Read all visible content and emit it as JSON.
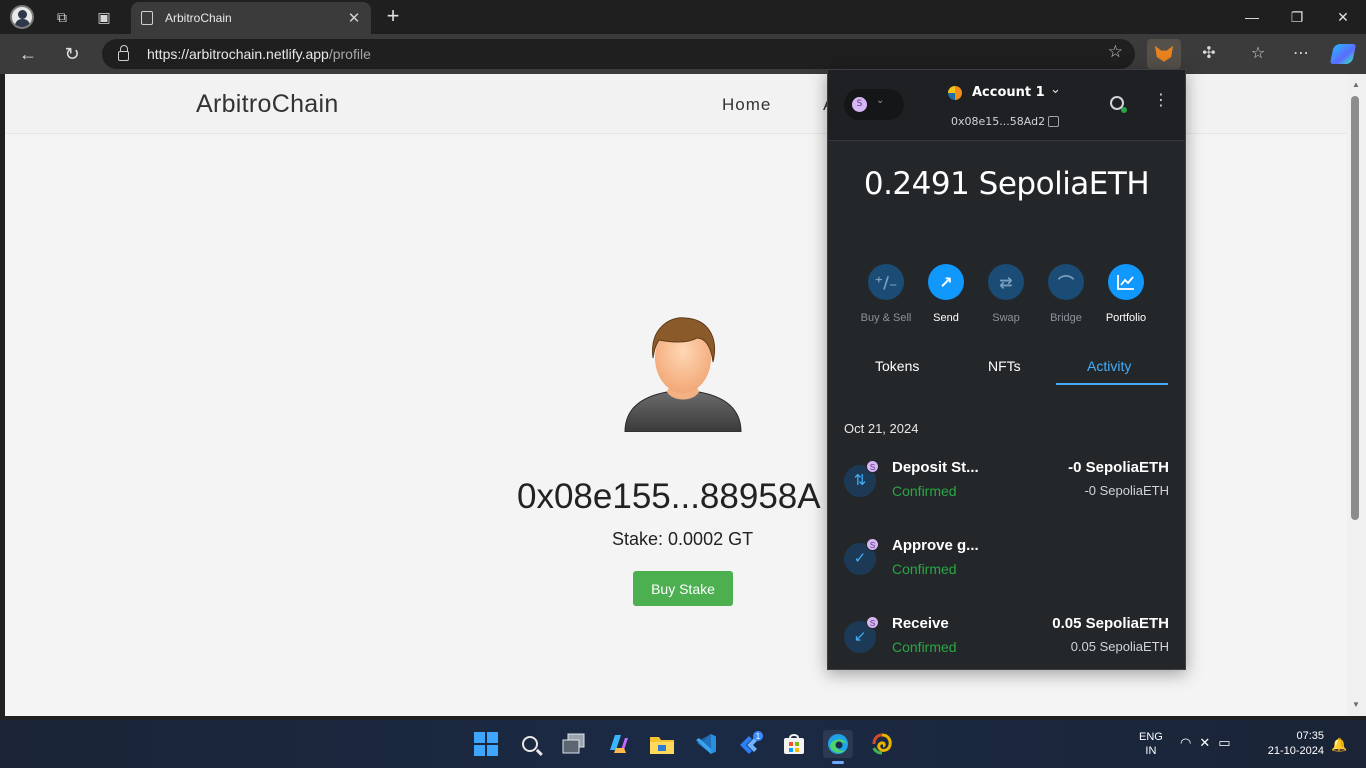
{
  "browser": {
    "tab_title": "ArbitroChain",
    "url_host": "https://arbitrochain.netlify.app",
    "url_path": "/profile"
  },
  "site": {
    "brand": "ArbitroChain",
    "nav_home": "Home",
    "nav_second_partial": "A",
    "address": "0x08e155...88958A",
    "stake": "Stake: 0.0002 GT",
    "buy_stake_label": "Buy Stake"
  },
  "metamask": {
    "network_badge": "S",
    "account_name": "Account 1",
    "account_address": "0x08e15...58Ad2",
    "balance": "0.2491 SepoliaETH",
    "actions": [
      {
        "label": "Buy & Sell",
        "glyph": "⁺∕₋",
        "enabled": false
      },
      {
        "label": "Send",
        "glyph": "↗",
        "enabled": true
      },
      {
        "label": "Swap",
        "glyph": "⇄",
        "enabled": false
      },
      {
        "label": "Bridge",
        "glyph": "⌒",
        "enabled": false
      },
      {
        "label": "Portfolio",
        "glyph": "📈",
        "enabled": true
      }
    ],
    "tabs": [
      "Tokens",
      "NFTs",
      "Activity"
    ],
    "active_tab": "Activity",
    "date_header": "Oct 21, 2024",
    "transactions": [
      {
        "title": "Deposit St...",
        "status": "Confirmed",
        "amount": "-0 SepoliaETH",
        "amount_secondary": "-0 SepoliaETH",
        "icon": "⇅"
      },
      {
        "title": "Approve g...",
        "status": "Confirmed",
        "amount": "",
        "amount_secondary": "",
        "icon": "✓"
      },
      {
        "title": "Receive",
        "status": "Confirmed",
        "amount": "0.05 SepoliaETH",
        "amount_secondary": "0.05 SepoliaETH",
        "icon": "↙"
      }
    ]
  },
  "taskbar": {
    "lang_line1": "ENG",
    "lang_line2": "IN",
    "time": "07:35",
    "date": "21-10-2024",
    "badge_count": "1"
  },
  "colors": {
    "accent_blue": "#1098fc",
    "confirmed_green": "#28a745",
    "buy_button_green": "#4caf50"
  }
}
